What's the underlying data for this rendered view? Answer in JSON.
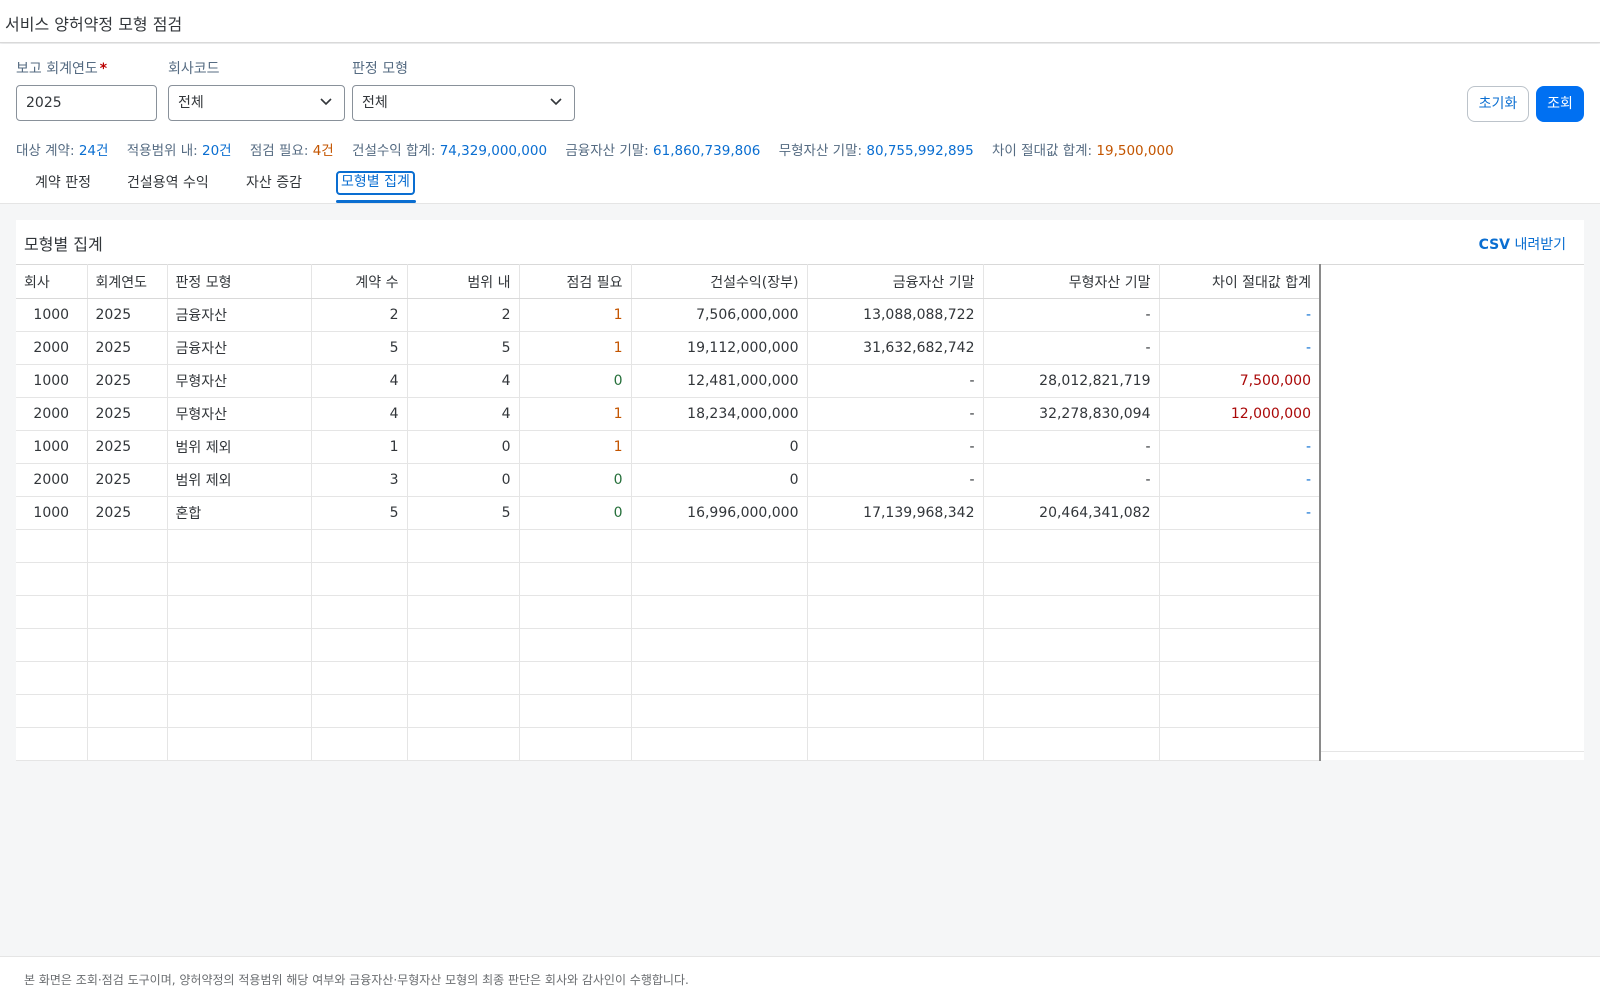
{
  "app": {
    "title": "서비스 양허약정 모형 점검"
  },
  "filters": {
    "year": {
      "label": "보고 회계연도",
      "required_mark": "*",
      "value": "2025"
    },
    "company": {
      "label": "회사코드",
      "value": "전체"
    },
    "model": {
      "label": "판정 모형",
      "value": "전체"
    }
  },
  "actions": {
    "reset": "초기화",
    "search": "조회"
  },
  "summary": [
    {
      "label": "대상 계약:",
      "value": "24건",
      "tone": "blue"
    },
    {
      "label": "적용범위 내:",
      "value": "20건",
      "tone": "blue"
    },
    {
      "label": "점검 필요:",
      "value": "4건",
      "tone": "orange"
    },
    {
      "label": "건설수익 합계:",
      "value": "74,329,000,000",
      "tone": "blue"
    },
    {
      "label": "금융자산 기말:",
      "value": "61,860,739,806",
      "tone": "blue"
    },
    {
      "label": "무형자산 기말:",
      "value": "80,755,992,895",
      "tone": "blue"
    },
    {
      "label": "차이 절대값 합계:",
      "value": "19,500,000",
      "tone": "orange"
    }
  ],
  "tabs": [
    {
      "label": "계약 판정",
      "active": false
    },
    {
      "label": "건설용역 수익",
      "active": false
    },
    {
      "label": "자산 증감",
      "active": false
    },
    {
      "label": "모형별 집계",
      "active": true
    }
  ],
  "panel": {
    "title": "모형별 집계",
    "csv_prefix": "CSV",
    "csv_label": " 내려받기",
    "columns": [
      "회사",
      "회계연도",
      "판정 모형",
      "계약 수",
      "범위 내",
      "점검 필요",
      "건설수익(장부)",
      "금융자산 기말",
      "무형자산 기말",
      "차이 절대값 합계"
    ],
    "rows": [
      [
        "1000",
        "2025",
        "금융자산",
        "2",
        "2",
        "1",
        "7,506,000,000",
        "13,088,088,722",
        "-",
        "-"
      ],
      [
        "2000",
        "2025",
        "금융자산",
        "5",
        "5",
        "1",
        "19,112,000,000",
        "31,632,682,742",
        "-",
        "-"
      ],
      [
        "1000",
        "2025",
        "무형자산",
        "4",
        "4",
        "0",
        "12,481,000,000",
        "-",
        "28,012,821,719",
        "7,500,000"
      ],
      [
        "2000",
        "2025",
        "무형자산",
        "4",
        "4",
        "1",
        "18,234,000,000",
        "-",
        "32,278,830,094",
        "12,000,000"
      ],
      [
        "1000",
        "2025",
        "범위 제외",
        "1",
        "0",
        "1",
        "0",
        "-",
        "-",
        "-"
      ],
      [
        "2000",
        "2025",
        "범위 제외",
        "3",
        "0",
        "0",
        "0",
        "-",
        "-",
        "-"
      ],
      [
        "1000",
        "2025",
        "혼합",
        "5",
        "5",
        "0",
        "16,996,000,000",
        "17,139,968,342",
        "20,464,341,082",
        "-"
      ]
    ],
    "empty_rows": 7
  },
  "footer": {
    "note": "본 화면은 조회·점검 도구이며, 양허약정의 적용범위 해당 여부와 금융자산·무형자산 모형의 최종 판단은 회사와 감사인이 수행합니다."
  },
  "colors": {
    "accent": "#0a6ed1",
    "primary_button": "#0070f2",
    "warning": "#c35500",
    "positive": "#256f3a",
    "negative": "#aa0808"
  },
  "icons": {
    "dropdown": "chevron-down-icon"
  }
}
